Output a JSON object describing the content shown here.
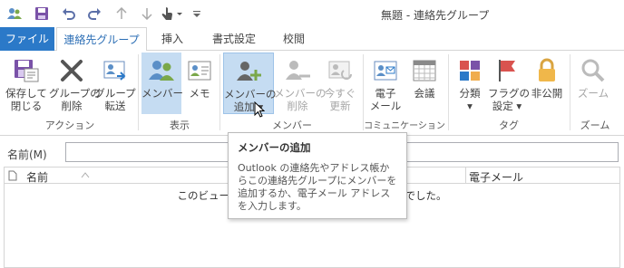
{
  "window": {
    "title": "無題 - 連絡先グループ"
  },
  "quick_access": {
    "icons": [
      "contacts-icon",
      "save-icon",
      "undo-icon",
      "redo-icon",
      "up-icon",
      "down-icon",
      "touch-icon",
      "customize-icon"
    ]
  },
  "tabs": {
    "file": "ファイル",
    "contact_group": "連絡先グループ",
    "insert": "挿入",
    "format": "書式設定",
    "review": "校閲"
  },
  "ribbon": {
    "save_close": [
      "保存して",
      "閉じる"
    ],
    "delete_group": [
      "グループの",
      "削除"
    ],
    "forward_group": [
      "グループ",
      "転送"
    ],
    "members": "メンバー",
    "notes": "メモ",
    "add_members": [
      "メンバーの",
      "追加"
    ],
    "remove_member": [
      "メンバーの",
      "削除"
    ],
    "update_now": [
      "今すぐ",
      "更新"
    ],
    "email": [
      "電子",
      "メール"
    ],
    "meeting": "会議",
    "categorize": "分類",
    "follow_up": [
      "フラグの",
      "設定"
    ],
    "private": "非公開",
    "zoom": "ズーム",
    "groups": {
      "actions": "アクション",
      "show": "表示",
      "members": "メンバー",
      "communicate": "コミュニケーション",
      "tags": "タグ",
      "zoom": "ズーム"
    }
  },
  "form": {
    "name_label": "名前(M)",
    "name_value": ""
  },
  "table": {
    "columns": [
      "名前",
      "電子メール"
    ],
    "empty_message": "このビューに表示するアイテムは見つかりませんでした。"
  },
  "tooltip": {
    "title": "メンバーの追加",
    "body": "Outlook の連絡先やアドレス帳からこの連絡先グループにメンバーを追加するか、電子メール アドレスを入力します。"
  },
  "colors": {
    "file_tab": "#2b79c8",
    "accent_blue": "#2b6eb5",
    "selected_bg": "#c5dcf2"
  }
}
